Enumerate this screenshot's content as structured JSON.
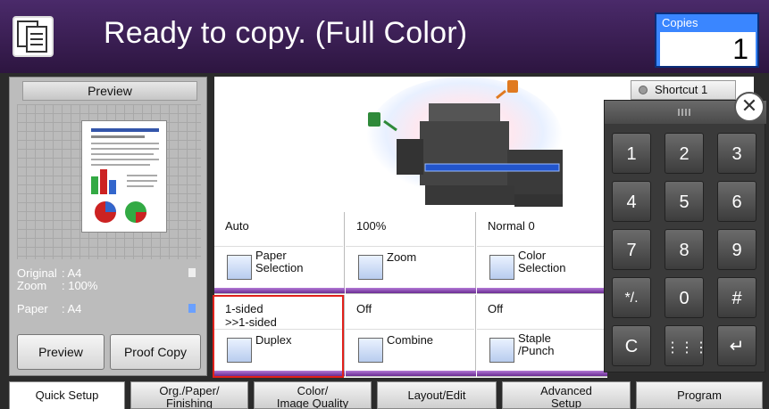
{
  "header": {
    "title": "Ready to copy. (Full Color)",
    "copies_label": "Copies",
    "copies_value": "1"
  },
  "preview": {
    "title": "Preview",
    "info": [
      {
        "key": "Original",
        "value": ": A4"
      },
      {
        "key": "Zoom",
        "value": ": 100%"
      },
      {
        "key": "Paper",
        "value": ": A4"
      }
    ],
    "preview_button": "Preview",
    "proof_copy_button": "Proof Copy"
  },
  "functions": [
    {
      "value": "Auto",
      "label": "Paper\nSelection"
    },
    {
      "value": "100%",
      "label": "Zoom"
    },
    {
      "value": "Normal 0",
      "label": "Color\nSelection"
    },
    {
      "value": "1-sided\n>>1-sided",
      "label": "Duplex"
    },
    {
      "value": "Off",
      "label": "Combine"
    },
    {
      "value": "Off",
      "label": "Staple\n/Punch"
    }
  ],
  "shortcut": {
    "label": "Shortcut 1"
  },
  "keypad": {
    "keys": [
      "1",
      "2",
      "3",
      "4",
      "5",
      "6",
      "7",
      "8",
      "9",
      "*/.",
      "0",
      "#",
      "C",
      "",
      ""
    ]
  },
  "tabs": [
    {
      "label": "Quick Setup"
    },
    {
      "label": "Org./Paper/\nFinishing"
    },
    {
      "label": "Color/\nImage Quality"
    },
    {
      "label": "Layout/Edit"
    },
    {
      "label": "Advanced\nSetup"
    },
    {
      "label": "Program"
    }
  ],
  "colors": {
    "accent_purple": "#6a2b92",
    "copies_blue": "#3a86ff",
    "highlight_red": "#e0201a"
  }
}
